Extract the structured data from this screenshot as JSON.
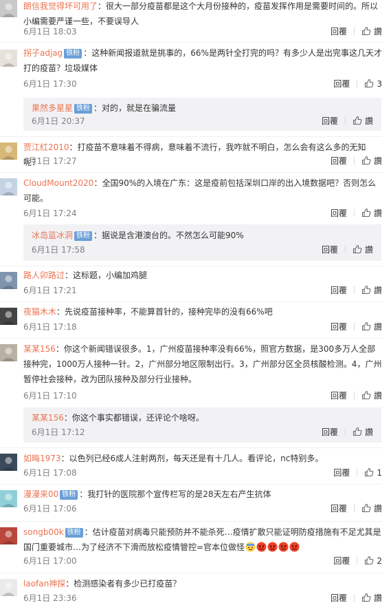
{
  "comments": [
    {
      "user": "朗信我觉得坏可用了",
      "text": "：很大一部分疫苗都是这个大月份接种的，疫苗发挥作用是需要时间的。所以小编需要严谨一些，不要误导人",
      "time": "6月1日 18:03",
      "reply_label": "回覆",
      "like_label": "讚"
    },
    {
      "user": "拐子adjag",
      "badge": "铁粉",
      "text": "：这种新闻报道就是挑事的，66%是两针全打完的吗？有多少人是出完事这几天才打的疫苗？垃圾媒体",
      "time": "6月1日 17:30",
      "reply_label": "回覆",
      "like_label": "3",
      "reply": {
        "user": "果然多星星",
        "badge": "铁粉",
        "text": "：对的，就是在骗流量",
        "time": "6月1日 20:37",
        "reply_label": "回覆",
        "like_label": "讚"
      }
    },
    {
      "user": "贾江红2010",
      "text": "：打疫苗不意味着不得病，意味着不流行，我咋就不明白，怎么会有这么多的无知呢？",
      "time": "6月1日 17:27",
      "reply_label": "回覆",
      "like_label": "讚"
    },
    {
      "user": "CloudMount2020",
      "text": "：全国90%的入境在广东：这是疫前包括深圳口岸的出入境数据吧？否则怎么可能。",
      "time": "6月1日 17:24",
      "reply_label": "回覆",
      "like_label": "讚",
      "reply": {
        "user": "冰岛蓝冰洞",
        "badge": "铁粉",
        "text": "：据说是含港澳台的。不然怎么可能90%",
        "time": "6月1日 17:58",
        "reply_label": "回覆",
        "like_label": "讚"
      }
    },
    {
      "user": "路人卯路过",
      "text": "：这标题，小编加鸡腿",
      "time": "6月1日 17:21",
      "reply_label": "回覆",
      "like_label": "讚"
    },
    {
      "user": "夜猫木木",
      "text": "：先说疫苗接种率，不能算首针的，接种完毕的没有66%吧",
      "time": "6月1日 17:18",
      "reply_label": "回覆",
      "like_label": "讚"
    },
    {
      "user": "某某156",
      "text": "：你这个新闻错误很多。1，广州疫苗接种率没有66%，照官方数据，是300多万人全部接种完，1000万人接种一针。2，广州部分地区限制出行。3，广州部分区全员核酸检测。4，广州暂停社会接种，改为团队接种及部分行业接种。",
      "time": "6月1日 17:10",
      "reply_label": "回覆",
      "like_label": "讚",
      "reply": {
        "user": "某某156",
        "text": "：你这个事实都错误，还评论个啥呀。",
        "time": "6月1日 17:12",
        "reply_label": "回覆",
        "like_label": "讚"
      }
    },
    {
      "user": "如晦1973",
      "text": "：以色列已经6成人注射两剂，每天还是有十几人。看评论，nc特别多。",
      "time": "6月1日 17:08",
      "reply_label": "回覆",
      "like_label": "1"
    },
    {
      "user": "漫漫来00",
      "badge": "铁粉",
      "text": "：我打针的医院那个宣传栏写的是28天左右产生抗体",
      "time": "6月1日 17:06",
      "reply_label": "回覆",
      "like_label": "讚"
    },
    {
      "user": "songb00k",
      "badge": "铁粉",
      "text": "：估计疫苗对病毒只能预防并不能杀死…疫情扩散只能证明防疫措施有不足尤其是国门重要城市…为了经济不下滑而放松疫情管控=官本位做怪",
      "emojis": [
        "sweat",
        "angry",
        "angry",
        "angry",
        "angry"
      ],
      "time": "6月1日 17:00",
      "reply_label": "回覆",
      "like_label": "2"
    },
    {
      "user": "laofan神探",
      "text": "：检测感染者有多少已打疫苗？",
      "time": "6月1日 23:36",
      "reply_label": "回覆",
      "like_label": "讚"
    }
  ],
  "icons": {
    "like": "thumbs-up-icon",
    "fan_badge": "fan-badge",
    "emoji": "emoji-icon"
  },
  "colors": {
    "username": "#eb7350",
    "badge": "#6a9fd8",
    "reply_bg": "#f2f2f5",
    "meta": "#808080"
  }
}
